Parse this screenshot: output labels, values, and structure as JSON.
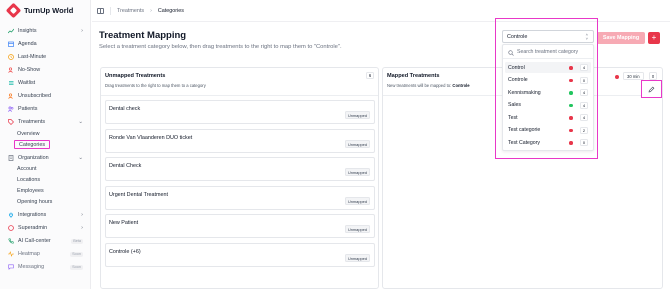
{
  "app": {
    "name": "TurnUp World",
    "brand_color": "#e8364a"
  },
  "sidebar": {
    "items": [
      {
        "label": "Insights",
        "icon": "chart-line-icon",
        "chevron": "right"
      },
      {
        "label": "Agenda",
        "icon": "calendar-icon"
      },
      {
        "label": "Last-Minute",
        "icon": "clock-icon"
      },
      {
        "label": "No-Show",
        "icon": "user-x-icon"
      },
      {
        "label": "Waitlist",
        "icon": "list-icon"
      },
      {
        "label": "Unsubscribed",
        "icon": "user-minus-icon"
      },
      {
        "label": "Patients",
        "icon": "users-icon"
      },
      {
        "label": "Treatments",
        "icon": "tag-icon",
        "chevron": "down"
      },
      {
        "label": "Organization",
        "icon": "building-icon",
        "chevron": "down"
      },
      {
        "label": "Integrations",
        "icon": "plug-icon",
        "chevron": "right"
      },
      {
        "label": "Superadmin",
        "icon": "shield-icon",
        "chevron": "right"
      },
      {
        "label": "AI Call-center",
        "icon": "phone-icon",
        "badge": "Beta"
      },
      {
        "label": "Heatmap",
        "icon": "activity-icon",
        "badge": "Soon"
      },
      {
        "label": "Messaging",
        "icon": "message-icon",
        "badge": "Soon"
      }
    ],
    "treatments_sub": [
      "Overview",
      "Categories"
    ],
    "organization_sub": [
      "Account",
      "Locations",
      "Employees",
      "Opening hours"
    ]
  },
  "breadcrumb": {
    "parent": "Treatments",
    "current": "Categories"
  },
  "page": {
    "title": "Treatment Mapping",
    "subtitle": "Select a treatment category below, then drag treatments to the right to map them to \"Controle\".",
    "save_label": "Save Mapping",
    "add_label": "+"
  },
  "unmapped": {
    "title": "Unmapped Treatments",
    "count": "6",
    "description": "Drag treatments to the right to map them to a category",
    "items": [
      {
        "name": "Dental check",
        "status": "Unmapped"
      },
      {
        "name": "Ronde Van Vlaanderen DUO ticket",
        "status": "Unmapped"
      },
      {
        "name": "Dental Check",
        "status": "Unmapped"
      },
      {
        "name": "Urgent Dental Treatment",
        "status": "Unmapped"
      },
      {
        "name": "New Patient",
        "status": "Unmapped"
      },
      {
        "name": "Controle (+6)",
        "status": "Unmapped"
      }
    ]
  },
  "mapped": {
    "title": "Mapped Treatments",
    "description_prefix": "New treatments will be mapped to:",
    "target": "Controle",
    "duration": "30 min",
    "count": "0"
  },
  "category_dropdown": {
    "selected": "Controle",
    "search_placeholder": "Search treatment category",
    "options": [
      {
        "label": "Control",
        "color": "#e8364a",
        "count": "4"
      },
      {
        "label": "Controle",
        "color": "#e8364a",
        "count": "0"
      },
      {
        "label": "Kennismaking",
        "color": "#22c55e",
        "count": "4"
      },
      {
        "label": "Sales",
        "color": "#22c55e",
        "count": "4"
      },
      {
        "label": "Test",
        "color": "#e8364a",
        "count": "4"
      },
      {
        "label": "Test categorie",
        "color": "#e8364a",
        "count": "2"
      },
      {
        "label": "Test Category",
        "color": "#e8364a",
        "count": "0"
      }
    ]
  }
}
